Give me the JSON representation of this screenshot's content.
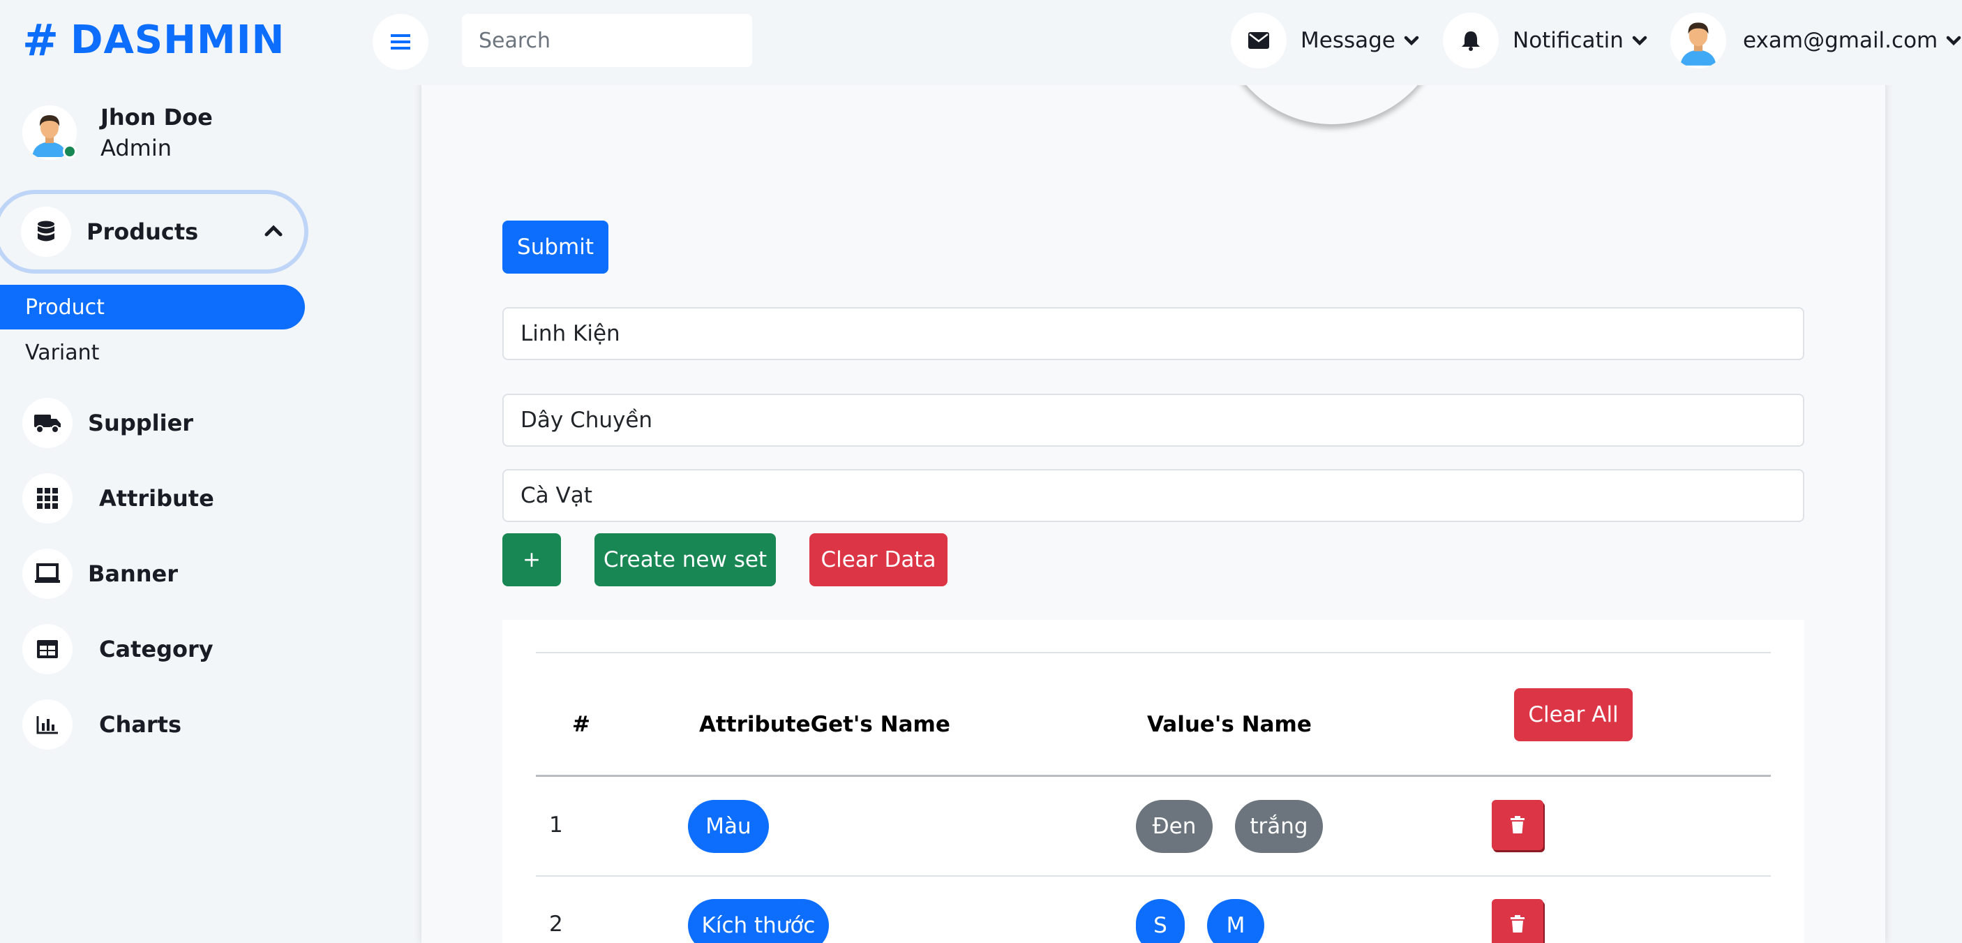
{
  "brand": {
    "hash": "#",
    "name": "DASHMIN"
  },
  "user": {
    "name": "Jhon Doe",
    "role": "Admin"
  },
  "sidebar": {
    "parent": {
      "label": "Products",
      "icon": "database-icon",
      "expanded": true
    },
    "subitems": [
      {
        "label": "Product",
        "active": true
      },
      {
        "label": "Variant",
        "active": false
      }
    ],
    "items": [
      {
        "label": "Supplier",
        "icon": "truck-icon"
      },
      {
        "label": "Attribute",
        "icon": "grid-icon"
      },
      {
        "label": "Banner",
        "icon": "laptop-icon"
      },
      {
        "label": "Category",
        "icon": "table-icon"
      },
      {
        "label": "Charts",
        "icon": "chart-bar-icon"
      }
    ]
  },
  "topbar": {
    "search_placeholder": "Search",
    "message_label": "Message",
    "notification_label": "Notificatin",
    "account_email": "exam@gmail.com"
  },
  "form": {
    "submit_label": "Submit",
    "fields": [
      "Linh Kiện",
      "Dây Chuyền",
      "Cà Vạt"
    ],
    "add_label": "+",
    "create_set_label": "Create new set",
    "clear_data_label": "Clear Data"
  },
  "table": {
    "headers": {
      "index": "#",
      "attribute": "AttributeGet's Name",
      "values": "Value's Name"
    },
    "clear_all_label": "Clear All",
    "rows": [
      {
        "index": "1",
        "attribute": "Màu",
        "values": [
          "Đen",
          "trắng"
        ]
      },
      {
        "index": "2",
        "attribute": "Kích thước",
        "values": [
          "S",
          "M"
        ]
      }
    ]
  },
  "colors": {
    "primary": "#0D6EFD",
    "success": "#198754",
    "danger": "#DC3545",
    "secondary": "#6C757D",
    "sidebar_bg": "#F3F6F9"
  }
}
